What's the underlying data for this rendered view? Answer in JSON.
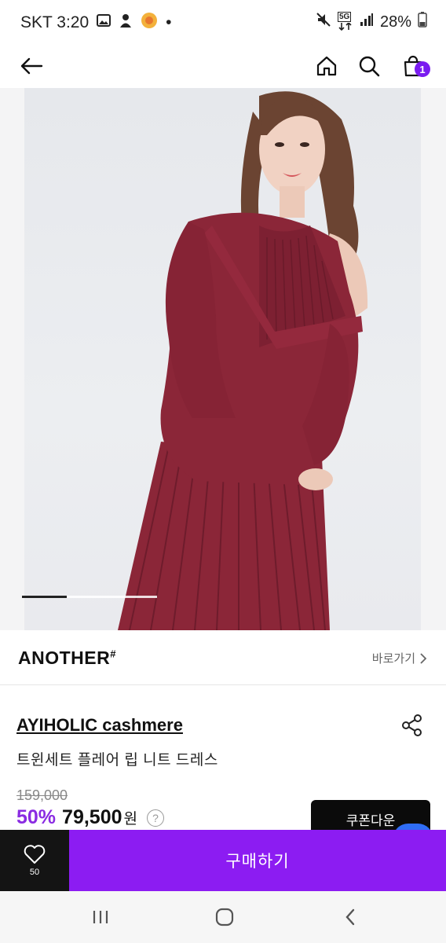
{
  "status_bar": {
    "carrier_time": "SKT 3:20",
    "dot": "•",
    "network": "5G",
    "battery": "28%",
    "icons": [
      "gallery-icon",
      "notification-icon",
      "app-icon",
      "mute-icon",
      "network-5g-icon",
      "signal-icon",
      "battery-icon"
    ]
  },
  "nav": {
    "cart_count": "1",
    "icons": [
      "back-arrow-icon",
      "home-icon",
      "search-icon",
      "cart-icon"
    ]
  },
  "hero": {
    "slide_progress": 0.33
  },
  "brand": {
    "name": "ANOTHER",
    "mark": "#",
    "link_label": "바로가기"
  },
  "product": {
    "name": "AYIHOLIC cashmere",
    "subtitle": "트윈세트 플레어 립 니트 드레스",
    "original_price": "159,000",
    "discount": "50%",
    "price": "79,500",
    "currency": "원",
    "help": "?",
    "coupon_label": "쿠폰다운"
  },
  "buy_bar": {
    "like_count": "50",
    "buy_label": "구매하기"
  },
  "colors": {
    "accent": "#8c1cf2",
    "discount": "#8a2be2",
    "badge": "#7a1cf0",
    "dark": "#141414",
    "sweater": "#8b2638"
  }
}
